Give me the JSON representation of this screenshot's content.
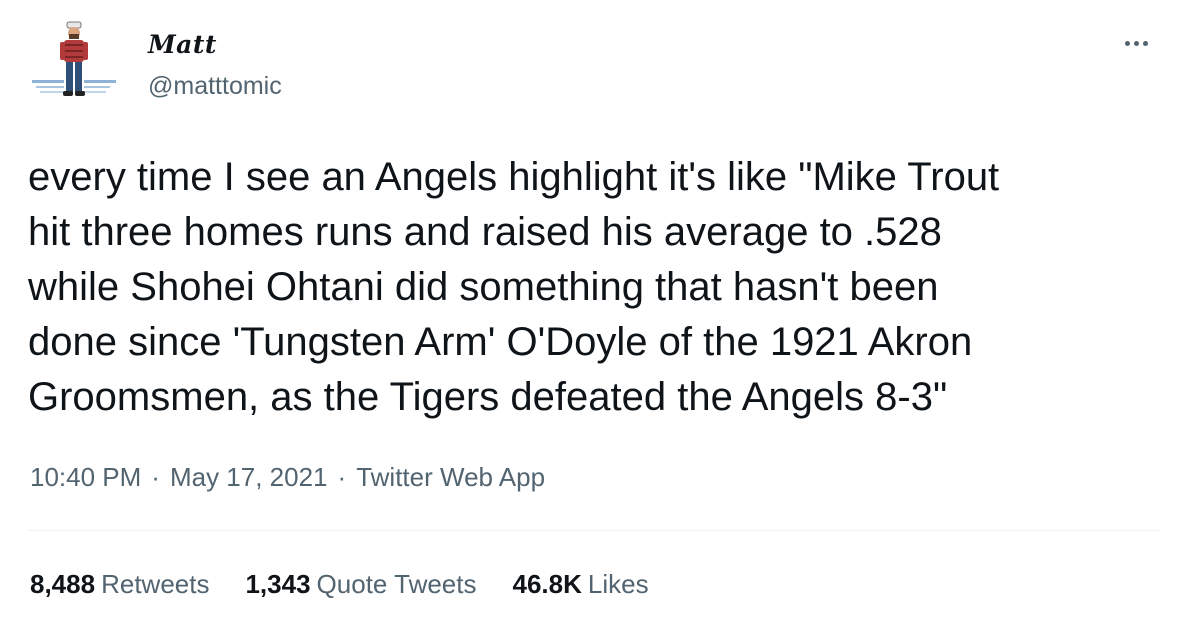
{
  "author": {
    "display_name": "Matt",
    "handle": "@matttomic",
    "avatar_icon": "cartoon-person-avatar"
  },
  "menu": {
    "more_icon": "more-horizontal-icon"
  },
  "tweet": {
    "text": "every time I see an Angels highlight it's like \"Mike Trout\nhit three homes runs and raised his average to .528\nwhile Shohei Ohtani did something that hasn't been\ndone since 'Tungsten Arm' O'Doyle of the 1921 Akron\nGroomsmen, as the Tigers defeated the Angels 8-3\""
  },
  "meta": {
    "time": "10:40 PM",
    "separator": "·",
    "date": "May 17, 2021",
    "source": "Twitter Web App"
  },
  "stats": {
    "retweets_count": "8,488",
    "retweets_label": "Retweets",
    "quotes_count": "1,343",
    "quotes_label": "Quote Tweets",
    "likes_count": "46.8K",
    "likes_label": "Likes"
  },
  "colors": {
    "text_primary": "#0f1419",
    "text_secondary": "#536471",
    "divider": "#eff3f4"
  }
}
